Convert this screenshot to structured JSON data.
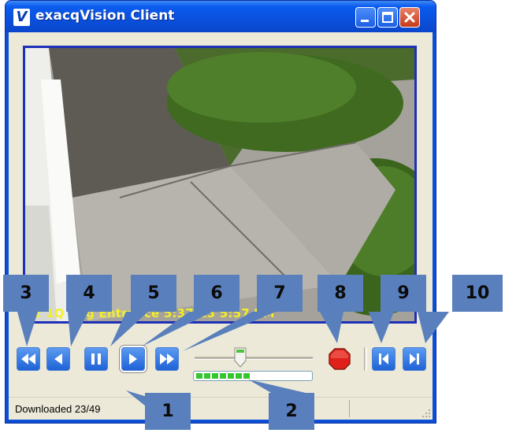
{
  "window": {
    "title": "exacqVision Client",
    "app_icon_letter": "V"
  },
  "video": {
    "overlay_text": "2 1Q Bag Entrance 5:37:13 5:57 PM"
  },
  "controls": {
    "buttons": [
      {
        "name": "fast-rewind",
        "icon": "fast-rewind-icon"
      },
      {
        "name": "step-back",
        "icon": "play-reverse-icon"
      },
      {
        "name": "pause",
        "icon": "pause-icon"
      },
      {
        "name": "play",
        "icon": "play-icon"
      },
      {
        "name": "fast-forward",
        "icon": "fast-forward-icon"
      },
      {
        "name": "stop-record",
        "icon": "stop-octagon-icon"
      },
      {
        "name": "go-to-start",
        "icon": "skip-to-start-icon"
      },
      {
        "name": "go-to-end",
        "icon": "skip-to-end-icon"
      }
    ],
    "download_progress_fraction": 0.47
  },
  "status": {
    "text": "Downloaded 23/49"
  },
  "callouts": [
    "1",
    "2",
    "3",
    "4",
    "5",
    "6",
    "7",
    "8",
    "9",
    "10"
  ],
  "colors": {
    "titlebar": "#0a50dc",
    "callout": "#5a7fbd",
    "overlay_text": "#f2ee2a",
    "progress": "#36c52e",
    "stop": "#e0201a"
  }
}
